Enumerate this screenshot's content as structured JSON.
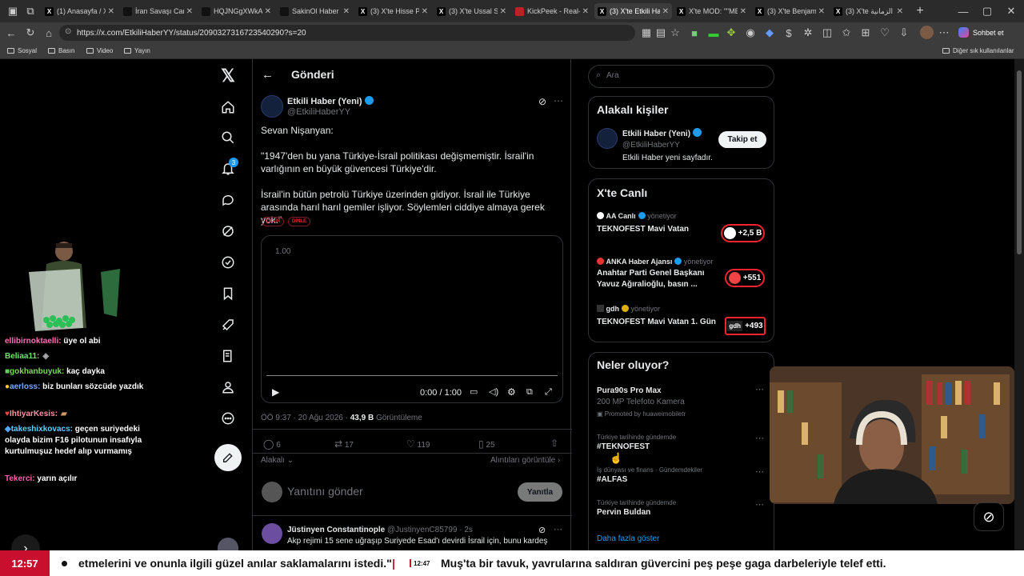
{
  "browser": {
    "tabs": [
      "(1) Anasayfa / X",
      "İran Savaşı Canlı",
      "HQJNGgXWkAAl",
      "SakinOl Haber M",
      "(3) X'te Hisse Par",
      "(3) X'te Ussal Sal",
      "KickPeek - Real-t",
      "(3) X'te Etkili Hab",
      "X'te MOD: \"\"ME",
      "(3) X'te Benjamin",
      "(3) X'te الزمانية"
    ],
    "url": "https://x.com/EtkiliHaberYY/status/2090327316723540290?s=20",
    "profile_label": "Sohbet et",
    "bookmarks": [
      "Sosyal",
      "Basın",
      "Video",
      "Yayın"
    ],
    "other_bookmarks": "Diğer sık kullanılanlar"
  },
  "nav": {
    "notif_count": "3"
  },
  "header": {
    "title": "Gönderi"
  },
  "post": {
    "name": "Etkili Haber (Yeni)",
    "handle": "@EtkiliHaberYY",
    "line1": "Sevan Nişanyan:",
    "line2": "\"1947'den bu yana Türkiye-İsrail politikası değişmemiştir. İsrail'in varlığının en büyük güvencesi Türkiye'dir.",
    "line3": "İsrail'in bütün petrolü Türkiye üzerinden gidiyor. İsrail ile Türkiye arasında harıl harıl gemiler işliyor. Söylemleri ciddiye almaya gerek yok.\"",
    "tag1": "ÇEVİR",
    "tag2": "DİNLE",
    "video_rate": "1.00",
    "video_time": "0:00 / 1:00",
    "time": "ÖÖ 9:37 · 20 Ağu 2026 · ",
    "views": "43,9 B",
    "views_label": " Görüntüleme",
    "replies": "6",
    "reposts": "17",
    "likes": "119",
    "bookmarks": "25",
    "sort": "Alakalı",
    "quotes": "Alıntıları görüntüle",
    "reply_placeholder": "Yanıtını gönder",
    "reply_btn": "Yanıtla"
  },
  "reply": {
    "name": "Jüstinyen Constantinople",
    "handle": "@JustinyenC85799 · 2s",
    "text": "Akp rejimi 15 sene uğraşıp Suriyede Esad'ı devirdi İsrail için, bunu kardeş"
  },
  "search": {
    "placeholder": "Ara"
  },
  "related": {
    "title": "Alakalı kişiler",
    "name": "Etkili Haber (Yeni)",
    "handle": "@EtkiliHaberYY",
    "bio": "Etkili Haber yeni sayfadır.",
    "follow": "Takip et"
  },
  "live": {
    "title": "X'te Canlı",
    "items": [
      {
        "host": "AA Canlı",
        "role": "yönetiyor",
        "title": "TEKNOFEST Mavi Vatan",
        "count": "+2,5 B"
      },
      {
        "host": "ANKA Haber Ajansı",
        "role": "yönetiyor",
        "title": "Anahtar Parti Genel Başkanı Yavuz Ağıralioğlu, basın ...",
        "count": "+551"
      },
      {
        "host": "gdh",
        "role": "yönetiyor",
        "title": "TEKNOFEST Mavi Vatan 1. Gün",
        "count": "+493",
        "avatar": "gdh"
      }
    ]
  },
  "trends": {
    "title": "Neler oluyor?",
    "items": [
      {
        "meta": "",
        "name": "Pura90s Pro Max",
        "sub": "200 MP Telefoto Kamera",
        "promo": "Promoted by huaweimobiletr"
      },
      {
        "meta": "Türkiye tarihinde gündemde",
        "name": "#TEKNOFEST"
      },
      {
        "meta": "İş dünyası ve finans · Gündemdekiler",
        "name": "#ALFAS"
      },
      {
        "meta": "Türkiye tarihinde gündemde",
        "name": "Pervin Buldan"
      }
    ],
    "more": "Daha fazla göster"
  },
  "chat": [
    {
      "user": "ellibirnoktaelli:",
      "msg": " üye ol abi",
      "color": "#ff6fb7"
    },
    {
      "user": "Beliaa11:",
      "msg": "",
      "color": "#6fe36f"
    },
    {
      "user": "gokhanbuyuk:",
      "msg": " kaç dayka",
      "color": "#7cd957"
    },
    {
      "user": "aerloss:",
      "msg": " biz bunları sözcüde yazdık",
      "color": "#7ea7ff"
    },
    {
      "user": "IhtiyarKesis:",
      "msg": "",
      "color": "#ff8fa3"
    },
    {
      "user": "takeshixkovacs:",
      "msg": " geçen suriyedeki olayda bizim F16 pilotunun insafıyla kurtulmuşuz hedef alıp vurmamış",
      "color": "#5fd0ff"
    },
    {
      "user": "Tekerci:",
      "msg": " yarın açılır",
      "color": "#ff5fb0"
    }
  ],
  "ticker": {
    "clock": "12:57",
    "text1": "etmelerini ve onunla ilgili güzel anılar saklamalarını istedi.\"",
    "time2": "12:47",
    "text2": "Muş'ta bir tavuk, yavrularına saldıran güvercini peş peşe gaga darbeleriyle telef etti."
  },
  "colors": {
    "accent": "#1d9bf0",
    "live_red": "#f4212e",
    "ticker_red": "#c8102e"
  }
}
